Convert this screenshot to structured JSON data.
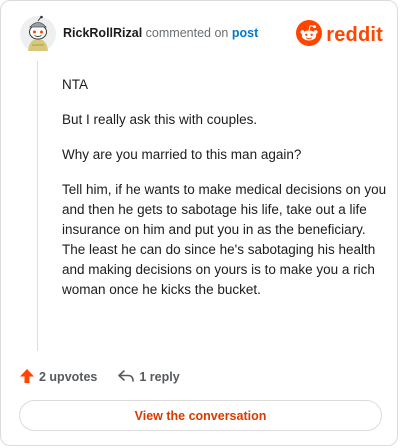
{
  "comment": {
    "username": "RickRollRizal",
    "action_text": "commented on",
    "target_link": "post",
    "paragraphs": [
      "NTA",
      "But I really ask this with couples.",
      "Why are you married to this man again?",
      "Tell him, if he wants to make medical decisions on you and then he gets to sabotage his life, take out a life insurance on him and put you in as the beneficiary. The least he can do since he's sabotaging his health and making decisions on yours is to make you a rich woman once he kicks the bucket."
    ]
  },
  "brand": {
    "wordmark": "reddit",
    "color": "#ff4500"
  },
  "footer": {
    "upvotes_label": "2 upvotes",
    "replies_label": "1 reply",
    "cta_label": "View the conversation"
  },
  "icons": {
    "avatar": "snoo-avatar-icon",
    "brand": "reddit-logo-icon",
    "upvote": "upvote-arrow-icon",
    "reply": "reply-arrow-icon"
  }
}
